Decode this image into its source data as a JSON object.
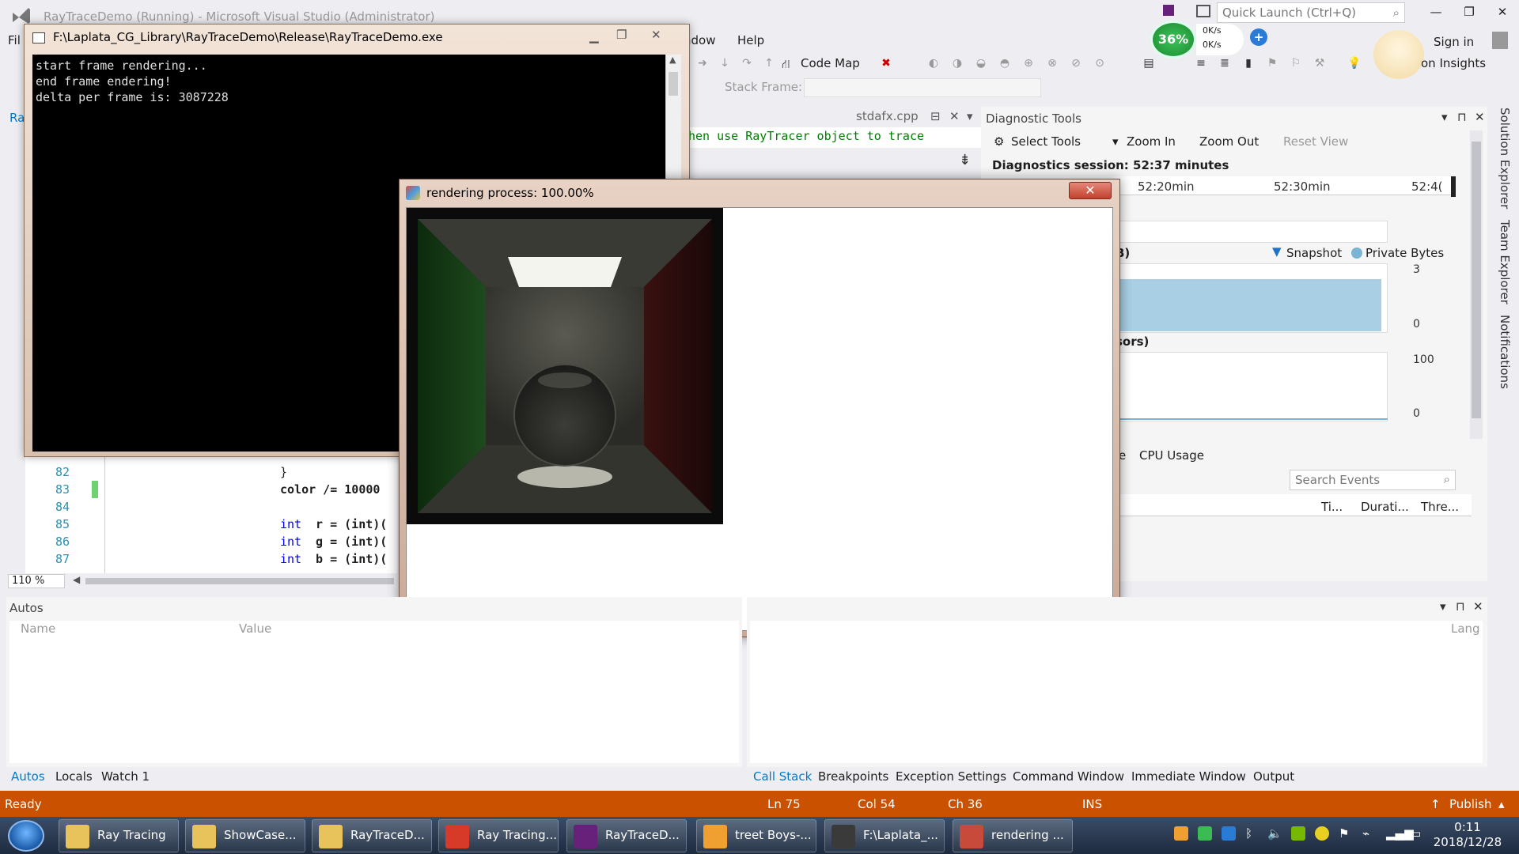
{
  "vs": {
    "title": "RayTraceDemo (Running) - Microsoft Visual Studio (Administrator)",
    "quick_launch_placeholder": "Quick Launch (Ctrl+Q)",
    "minimize": "—",
    "restore": "❐",
    "close": "✕",
    "sign_in": "Sign in",
    "menu_help": "Help",
    "menu_window_partial": "ndow",
    "menu_file_partial": "Fil",
    "toolbar_code_map": "Code Map",
    "toolbar_insights": "on Insights",
    "toolbar_stack_frame": "Stack Frame:",
    "net_percent": "36%",
    "net_up": "0K/s",
    "net_down": "0K/s"
  },
  "console": {
    "title": "F:\\Laplata_CG_Library\\RayTraceDemo\\Release\\RayTraceDemo.exe",
    "lines": "start frame rendering...\nend frame endering!\ndelta per frame is: 3087228"
  },
  "editor": {
    "file_tab": "stdafx.cpp",
    "comment_partial": "hen use RayTracer object to trace",
    "zoom": "110 %",
    "lines": [
      {
        "num": "82",
        "code": "}"
      },
      {
        "num": "83",
        "code": "color /= 10000"
      },
      {
        "num": "84",
        "code": ""
      },
      {
        "num": "85",
        "kw": "int",
        "rest": " r = (int)(",
        "kw2": "int"
      },
      {
        "num": "86",
        "kw": "int",
        "rest": " g = (int)(",
        "kw2": "int"
      },
      {
        "num": "87",
        "kw": "int",
        "rest": " b = (int)(",
        "kw2": "int"
      }
    ],
    "left_tab_partial": "Ra"
  },
  "render_window": {
    "title": "rendering process: 100.00%",
    "close": "✕"
  },
  "diagnostics": {
    "title": "Diagnostic Tools",
    "select_tools": "Select Tools",
    "zoom_in": "Zoom In",
    "zoom_out": "Zoom Out",
    "reset_view": "Reset View",
    "session": "Diagnostics session: 52:37 minutes",
    "ticks": [
      "52:20min",
      "52:30min",
      "52:4("
    ],
    "mem_label_partial": "B)",
    "legend_snapshot": "Snapshot",
    "legend_private": "Private Bytes",
    "mem_max": "3",
    "mem_min": "0",
    "cpu_label_partial": "sors)",
    "cpu_max": "100",
    "cpu_min": "0",
    "tab_partial": "e",
    "tab_cpu": "CPU Usage",
    "search_placeholder": "Search Events",
    "columns": [
      "Ti...",
      "Durati...",
      "Thre..."
    ]
  },
  "side_tabs": [
    "Solution Explorer",
    "Team Explorer",
    "Notifications"
  ],
  "autos": {
    "title": "Autos",
    "col_name": "Name",
    "col_value": "Value",
    "tabs": [
      "Autos",
      "Locals",
      "Watch 1"
    ]
  },
  "callstack": {
    "col_lang": "Lang",
    "tabs": [
      "Call Stack",
      "Breakpoints",
      "Exception Settings",
      "Command Window",
      "Immediate Window",
      "Output"
    ]
  },
  "status": {
    "ready": "Ready",
    "ln": "Ln 75",
    "col": "Col 54",
    "ch": "Ch 36",
    "ins": "INS",
    "publish": "Publish"
  },
  "taskbar": {
    "items": [
      {
        "label": "Ray Tracing",
        "icon": "folder-icon",
        "color": "#e8c25a"
      },
      {
        "label": "ShowCase...",
        "icon": "folder-icon",
        "color": "#e8c25a"
      },
      {
        "label": "RayTraceD...",
        "icon": "folder-icon",
        "color": "#e8c25a"
      },
      {
        "label": "Ray Tracing...",
        "icon": "pdf-icon",
        "color": "#d83a2a"
      },
      {
        "label": "RayTraceD...",
        "icon": "visual-studio-icon",
        "color": "#68217a"
      },
      {
        "label": "treet Boys-...",
        "icon": "music-icon",
        "color": "#f0a030"
      },
      {
        "label": "F:\\Laplata_...",
        "icon": "console-icon",
        "color": "#3a3a3a"
      },
      {
        "label": "rendering ...",
        "icon": "app-icon",
        "color": "#c84a3a"
      }
    ],
    "time": "0:11",
    "date": "2018/12/28"
  }
}
